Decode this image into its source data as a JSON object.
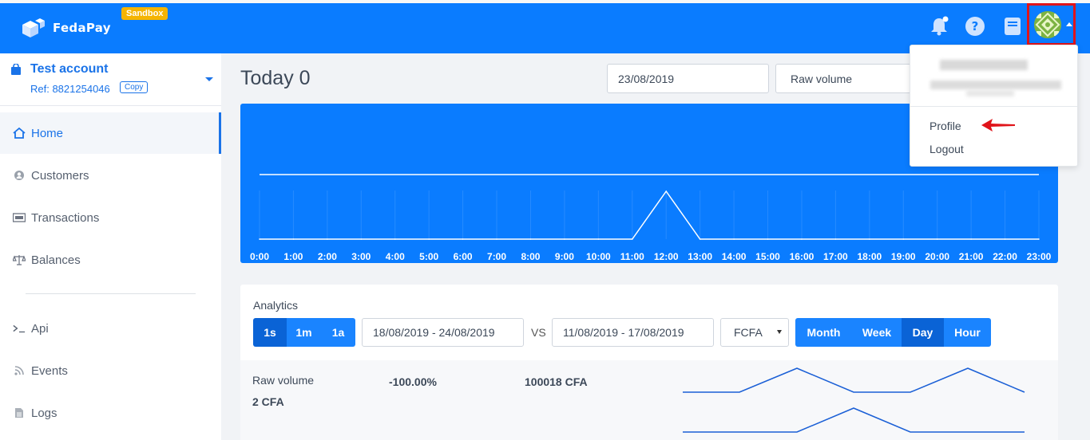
{
  "header": {
    "brand": "FedaPay",
    "env_badge": "Sandbox",
    "icons": [
      "bell-icon",
      "help-icon",
      "book-icon",
      "avatar"
    ]
  },
  "account": {
    "name": "Test account",
    "ref": "Ref: 8821254046",
    "copy_label": "Copy"
  },
  "sidebar": {
    "items": [
      {
        "label": "Home",
        "icon": "home-icon"
      },
      {
        "label": "Customers",
        "icon": "user-icon"
      },
      {
        "label": "Transactions",
        "icon": "card-icon"
      },
      {
        "label": "Balances",
        "icon": "scale-icon"
      },
      {
        "label": "Api",
        "icon": "terminal-icon"
      },
      {
        "label": "Events",
        "icon": "rss-icon"
      },
      {
        "label": "Logs",
        "icon": "document-icon"
      }
    ]
  },
  "main": {
    "title": "Today 0",
    "date": "23/08/2019",
    "metric": "Raw volume"
  },
  "chart_data": {
    "type": "line",
    "x": [
      "0:00",
      "1:00",
      "2:00",
      "3:00",
      "4:00",
      "5:00",
      "6:00",
      "7:00",
      "8:00",
      "9:00",
      "10:00",
      "11:00",
      "12:00",
      "13:00",
      "14:00",
      "15:00",
      "16:00",
      "17:00",
      "18:00",
      "19:00",
      "20:00",
      "21:00",
      "22:00",
      "23:00"
    ],
    "series": [
      {
        "values": [
          0,
          0,
          0,
          0,
          0,
          0,
          0,
          0,
          0,
          0,
          0,
          0,
          1,
          0,
          0,
          0,
          0,
          0,
          0,
          0,
          0,
          0,
          0,
          0
        ]
      }
    ]
  },
  "analytics": {
    "label": "Analytics",
    "range_buttons": [
      "1s",
      "1m",
      "1a"
    ],
    "range_selected": "1s",
    "period": "18/08/2019 - 24/08/2019",
    "vs_label": "VS",
    "compare_period": "11/08/2019 - 17/08/2019",
    "currency": "FCFA",
    "granularity": [
      "Month",
      "Week",
      "Day",
      "Hour"
    ],
    "granularity_selected": "Day",
    "row": {
      "label": "Raw volume",
      "value": "2 CFA",
      "change": "-100.00%",
      "compare_value": "100018 CFA"
    }
  },
  "dropdown": {
    "items": [
      "Profile",
      "Logout"
    ]
  }
}
